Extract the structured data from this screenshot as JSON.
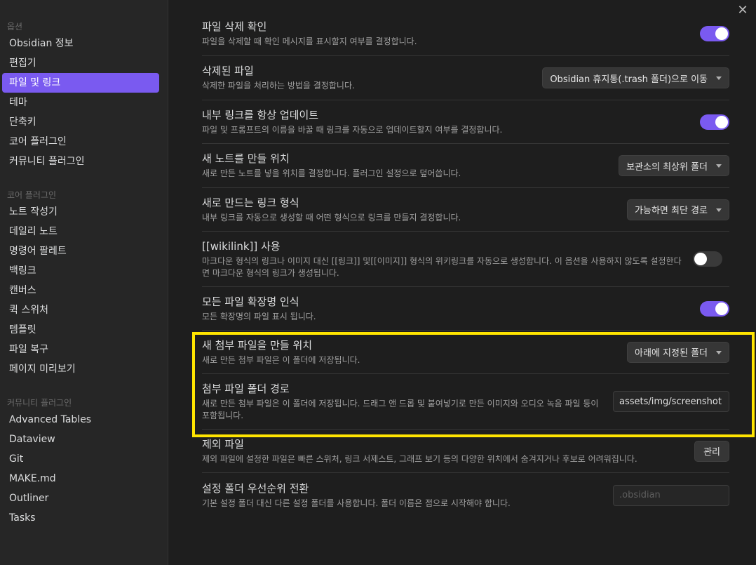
{
  "sidebar": {
    "sections": [
      {
        "heading": "옵션",
        "items": [
          {
            "label": "Obsidian 정보",
            "active": false
          },
          {
            "label": "편집기",
            "active": false
          },
          {
            "label": "파일 및 링크",
            "active": true
          },
          {
            "label": "테마",
            "active": false
          },
          {
            "label": "단축키",
            "active": false
          },
          {
            "label": "코어 플러그인",
            "active": false
          },
          {
            "label": "커뮤니티 플러그인",
            "active": false
          }
        ]
      },
      {
        "heading": "코어 플러그인",
        "items": [
          {
            "label": "노트 작성기",
            "active": false
          },
          {
            "label": "데일리 노트",
            "active": false
          },
          {
            "label": "명령어 팔레트",
            "active": false
          },
          {
            "label": "백링크",
            "active": false
          },
          {
            "label": "캔버스",
            "active": false
          },
          {
            "label": "퀵 스위처",
            "active": false
          },
          {
            "label": "템플릿",
            "active": false
          },
          {
            "label": "파일 복구",
            "active": false
          },
          {
            "label": "페이지 미리보기",
            "active": false
          }
        ]
      },
      {
        "heading": "커뮤니티 플러그인",
        "items": [
          {
            "label": "Advanced Tables",
            "active": false
          },
          {
            "label": "Dataview",
            "active": false
          },
          {
            "label": "Git",
            "active": false
          },
          {
            "label": "MAKE.md",
            "active": false
          },
          {
            "label": "Outliner",
            "active": false
          },
          {
            "label": "Tasks",
            "active": false
          }
        ]
      }
    ]
  },
  "close_icon": "✕",
  "settings": [
    {
      "title": "파일 삭제 확인",
      "desc": "파일을 삭제할 때 확인 메시지를 표시할지 여부를 결정합니다.",
      "control": "toggle",
      "on": true
    },
    {
      "title": "삭제된 파일",
      "desc": "삭제한 파일을 처리하는 방법을 결정합니다.",
      "control": "dropdown",
      "value": "Obsidian 휴지통(.trash 폴더)으로 이동"
    },
    {
      "title": "내부 링크를 항상 업데이트",
      "desc": "파일 및 프롬프트의 이름을 바꿀 때 링크를 자동으로 업데이트할지 여부를 결정합니다.",
      "control": "toggle",
      "on": true
    },
    {
      "title": "새 노트를 만들 위치",
      "desc": "새로 만든 노트를 넣을 위치를 결정합니다. 플러그인 설정으로 덮어씁니다.",
      "control": "dropdown",
      "value": "보관소의 최상위 폴더"
    },
    {
      "title": "새로 만드는 링크 형식",
      "desc": "내부 링크를 자동으로 생성할 때 어떤 형식으로 링크를 만들지 결정합니다.",
      "control": "dropdown",
      "value": "가능하면 최단 경로"
    },
    {
      "title": "[[wikilink]] 사용",
      "desc": "마크다운 형식의 링크나 이미지 대신 [[링크]] 및[[이미지]] 형식의 위키링크를 자동으로 생성합니다. 이 옵션을 사용하지 않도록 설정한다면 마크다운 형식의 링크가 생성됩니다.",
      "control": "toggle",
      "on": false
    },
    {
      "title": "모든 파일 확장명 인식",
      "desc": "모든 확장명의 파일 표시 됩니다.",
      "control": "toggle",
      "on": true
    },
    {
      "title": "새 첨부 파일을 만들 위치",
      "desc": "새로 만든 첨부 파일은 이 폴더에 저장됩니다.",
      "control": "dropdown",
      "value": "아래에 지정된 폴더"
    },
    {
      "title": "첨부 파일 폴더 경로",
      "desc": "새로 만든 첨부 파일은 이 폴더에 저장됩니다. 드래그 앤 드롭 및 붙여넣기로 만든 이미지와 오디오 녹음 파일 등이 포함됩니다.",
      "control": "text",
      "value": "assets/img/screenshot",
      "placeholder": ""
    },
    {
      "title": "제외 파일",
      "desc": "제외 파일에 설정한 파일은 빠른 스위처, 링크 서제스트, 그래프 보기 등의 다양한 위치에서 숨겨지거나 후보로 어려워집니다.",
      "control": "button",
      "value": "관리"
    },
    {
      "title": "설정 폴더 우선순위 전환",
      "desc": "기본 설정 폴더 대신 다른 설정 폴더를 사용합니다. 폴더 이름은 점으로 시작해야 합니다.",
      "control": "text",
      "value": "",
      "placeholder": ".obsidian"
    }
  ],
  "colors": {
    "accent": "#7a5af0",
    "highlight": "#ffe400",
    "background": "#1e1e1e",
    "sidebar": "#262626"
  }
}
